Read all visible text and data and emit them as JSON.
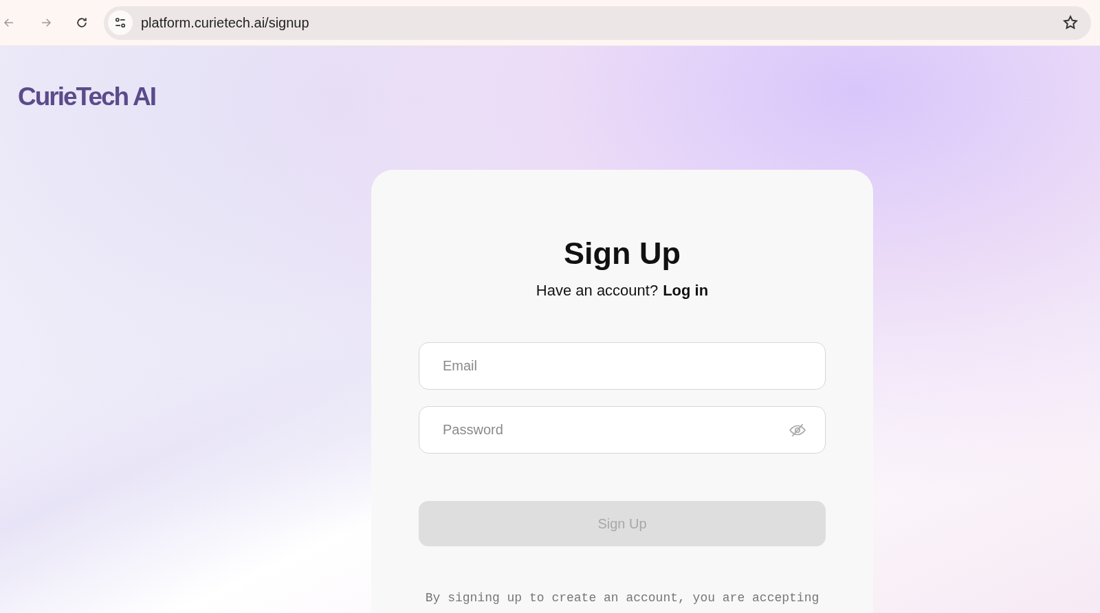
{
  "browser": {
    "url": "platform.curietech.ai/signup"
  },
  "logo": "CurieTech AI",
  "card": {
    "title": "Sign Up",
    "prompt": "Have an account?",
    "login_link": "Log in",
    "fields": [
      {
        "kind": "email",
        "placeholder": "Email"
      },
      {
        "kind": "password",
        "placeholder": "Password"
      }
    ],
    "submit": {
      "label": "Sign Up",
      "disabled": true
    },
    "terms": "By signing up to create an account, you are accepting"
  }
}
